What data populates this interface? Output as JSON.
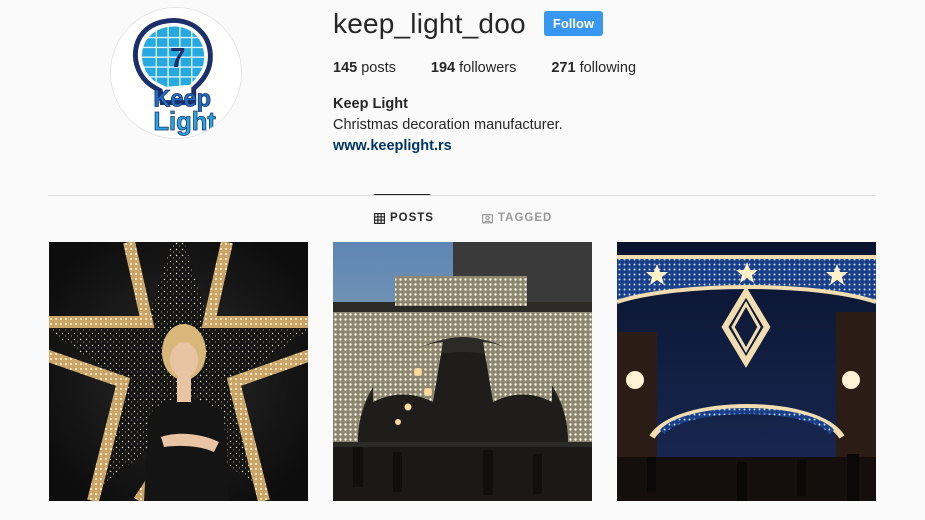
{
  "profile": {
    "username": "keep_light_doo",
    "follow_label": "Follow",
    "posts_count": "145",
    "posts_label": "posts",
    "followers_count": "194",
    "followers_label": "followers",
    "following_count": "271",
    "following_label": "following",
    "full_name": "Keep Light",
    "bio": "Christmas decoration manufacturer.",
    "website": "www.keeplight.rs",
    "avatar_logo_text": "Keep Light",
    "avatar_logo_number": "7"
  },
  "tabs": [
    {
      "label": "POSTS",
      "icon": "grid-icon",
      "active": true
    },
    {
      "label": "TAGGED",
      "icon": "tag-icon",
      "active": false
    }
  ],
  "posts": [
    {
      "subject": "woman-inside-illuminated-star"
    },
    {
      "subject": "street-light-arch-tunnel"
    },
    {
      "subject": "street-garland-with-stars-night"
    }
  ],
  "colors": {
    "accent": "#3897f0",
    "link": "#003569",
    "background": "#fafafa",
    "logo_blue": "#1d72c2",
    "logo_navy": "#1b2f6b"
  }
}
